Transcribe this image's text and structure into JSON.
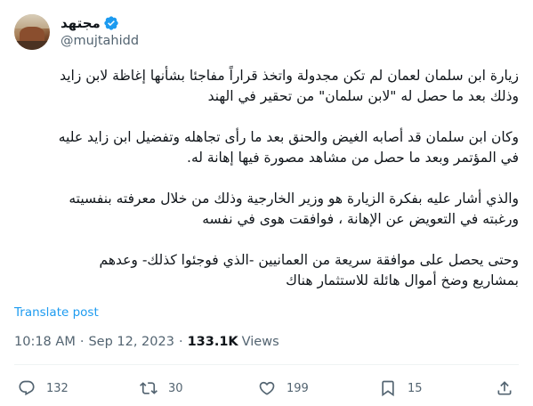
{
  "author": {
    "display_name": "مجتهد",
    "handle": "@mujtahidd",
    "verified": true
  },
  "tweet": {
    "paragraphs": [
      "زيارة ابن سلمان لعمان لم تكن مجدولة واتخذ قراراً مفاجئا بشأنها إغاظة لابن زايد\nوذلك بعد ما حصل له \"لابن سلمان\" من تحقير في الهند",
      "وكان ابن سلمان قد أصابه الغيض والحنق بعد ما رأى تجاهله وتفضيل ابن زايد عليه\nفي المؤتمر وبعد ما حصل من مشاهد مصورة فيها إهانة له.",
      "والذي أشار عليه بفكرة الزيارة هو وزير الخارجية وذلك من خلال معرفته بنفسيته\nورغبته في التعويض عن الإهانة ، فوافقت هوى في نفسه",
      "وحتى يحصل على موافقة سريعة من العمانيين -الذي فوجئوا كذلك- وعدهم\nبمشاريع وضخ أموال هائلة للاستثمار هناك"
    ],
    "translate_label": "Translate post",
    "time": "10:18 AM",
    "separator": "·",
    "date": "Sep 12, 2023",
    "views_count": "133.1K",
    "views_label": "Views"
  },
  "actions": {
    "reply_count": "132",
    "retweet_count": "30",
    "like_count": "199",
    "bookmark_count": "15"
  },
  "colors": {
    "accent": "#1d9bf0",
    "text": "#0f1419",
    "secondary": "#536471",
    "divider": "#eff3f4"
  },
  "icons": [
    "verified-badge-icon",
    "reply-icon",
    "retweet-icon",
    "like-icon",
    "bookmark-icon",
    "share-icon"
  ]
}
